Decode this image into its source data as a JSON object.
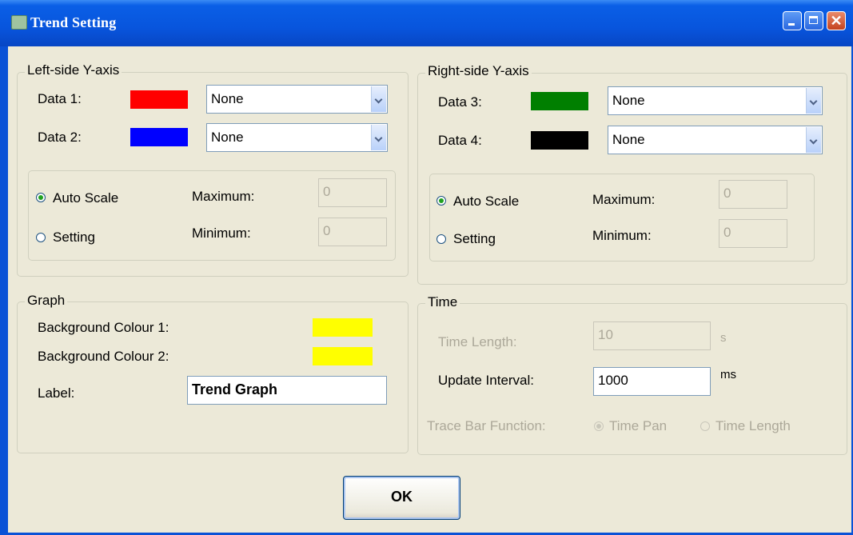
{
  "window": {
    "title": "Trend Setting",
    "close_glyph": "✕"
  },
  "left_axis": {
    "legend": "Left-side Y-axis",
    "data1": {
      "label": "Data 1:",
      "color": "#ff0000",
      "selection": "None"
    },
    "data2": {
      "label": "Data 2:",
      "color": "#0000ff",
      "selection": "None"
    },
    "auto_scale_label": "Auto Scale",
    "setting_label": "Setting",
    "mode": "Auto Scale",
    "maximum_label": "Maximum:",
    "maximum_value": "0",
    "minimum_label": "Minimum:",
    "minimum_value": "0"
  },
  "right_axis": {
    "legend": "Right-side Y-axis",
    "data3": {
      "label": "Data 3:",
      "color": "#007f00",
      "selection": "None"
    },
    "data4": {
      "label": "Data 4:",
      "color": "#000000",
      "selection": "None"
    },
    "auto_scale_label": "Auto Scale",
    "setting_label": "Setting",
    "mode": "Auto Scale",
    "maximum_label": "Maximum:",
    "maximum_value": "0",
    "minimum_label": "Minimum:",
    "minimum_value": "0"
  },
  "graph": {
    "legend": "Graph",
    "bg1_label": "Background Colour 1:",
    "bg1_color": "#ffff00",
    "bg2_label": "Background Colour 2:",
    "bg2_color": "#ffff00",
    "label_label": "Label:",
    "label_value": "Trend Graph"
  },
  "time": {
    "legend": "Time",
    "length_label": "Time Length:",
    "length_value": "10",
    "length_unit": "s",
    "interval_label": "Update Interval:",
    "interval_value": "1000",
    "interval_unit": "ms",
    "trace_label": "Trace Bar Function:",
    "time_pan_label": "Time Pan",
    "time_length_label": "Time Length",
    "trace_mode": "Time Pan"
  },
  "ok_label": "OK"
}
